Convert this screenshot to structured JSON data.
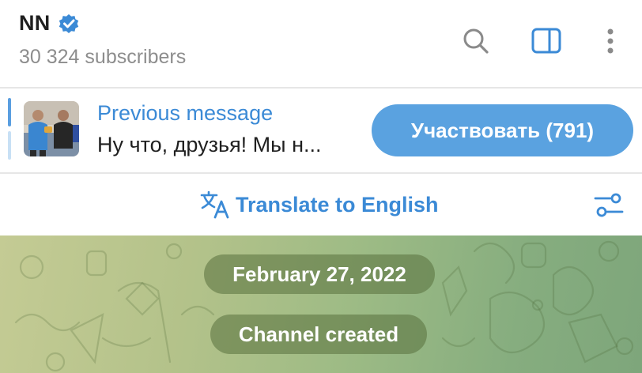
{
  "header": {
    "title": "NN",
    "subtitle": "30 324 subscribers"
  },
  "icons": {
    "verified": "verified-badge-icon",
    "search": "search-icon",
    "sidebar": "sidebar-toggle-icon",
    "more": "more-vertical-icon",
    "translate": "translate-icon",
    "settings": "settings-sliders-icon"
  },
  "pinned": {
    "title": "Previous message",
    "text": "Ну что, друзья!  Мы н...",
    "button_label": "Участвовать (791)"
  },
  "translate": {
    "label": "Translate to English"
  },
  "chat": {
    "date": "February 27, 2022",
    "service_message": "Channel created"
  },
  "colors": {
    "accent": "#3b8ad6",
    "button": "#5aa2e0",
    "verified": "#3b8ad6"
  }
}
